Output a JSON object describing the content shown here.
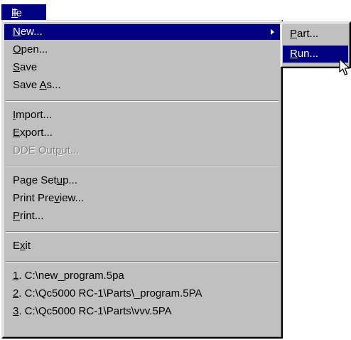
{
  "menubar": {
    "file": {
      "accel": "F",
      "rest": "ile"
    }
  },
  "menu": {
    "new": {
      "accel": "N",
      "rest": "ew..."
    },
    "open": {
      "accel": "O",
      "rest": "pen..."
    },
    "save": {
      "accel": "S",
      "rest": "ave"
    },
    "save_as": {
      "pre": "Save ",
      "accel": "A",
      "rest": "s..."
    },
    "import": {
      "accel": "I",
      "rest": "mport..."
    },
    "export": {
      "accel": "E",
      "rest": "xport..."
    },
    "dde_output": {
      "pre": "DDE Out",
      "accel": "p",
      "rest": "ut..."
    },
    "page_setup": {
      "pre": "Page Set",
      "accel": "u",
      "rest": "p..."
    },
    "print_preview": {
      "pre": "Print Pre",
      "accel": "v",
      "rest": "iew..."
    },
    "print": {
      "accel": "P",
      "rest": "rint..."
    },
    "exit": {
      "pre": "E",
      "accel": "x",
      "rest": "it"
    },
    "recent": [
      {
        "accel": "1",
        "rest": ". C:\\new_program.5pa"
      },
      {
        "accel": "2",
        "rest": ". C:\\Qc5000 RC-1\\Parts\\_program.5PA"
      },
      {
        "accel": "3",
        "rest": ". C:\\Qc5000 RC-1\\Parts\\vvv.5PA"
      }
    ]
  },
  "submenu": {
    "part": {
      "accel": "P",
      "rest": "art..."
    },
    "run": {
      "accel": "R",
      "rest": "un..."
    }
  },
  "icons": {
    "submenu_arrow": "triangle-right",
    "cursor": "arrow-pointer"
  },
  "colors": {
    "menu_bg": "#c0c0c0",
    "highlight": "#000080",
    "highlight_text": "#ffffff",
    "disabled": "#808080"
  }
}
